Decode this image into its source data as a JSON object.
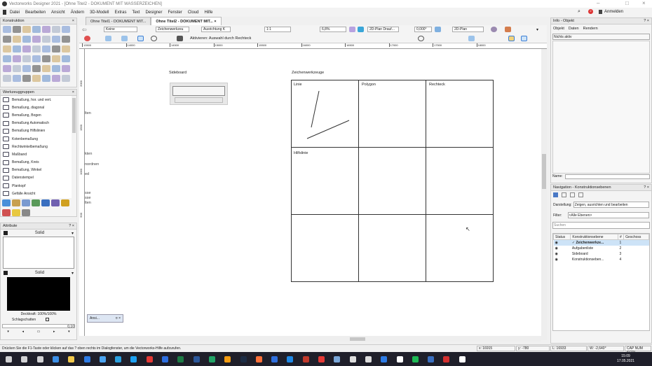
{
  "window": {
    "title": "Vectorworks Designer 2021 - [Ohne Titel2 - DOKUMENT MIT WASSERZEICHEN]",
    "account": "Anmelden",
    "notification_count": "2"
  },
  "menu": [
    "Datei",
    "Bearbeiten",
    "Ansicht",
    "Ändern",
    "3D-Modell",
    "Extras",
    "Text",
    "Designer",
    "Fenster",
    "Cloud",
    "Hilfe"
  ],
  "document_tabs": [
    {
      "label": "Ohne Titel1 - DOKUMENT MIT...",
      "active": false
    },
    {
      "label": "Ohne Titel2 - DOKUMENT MIT...",
      "active": true
    }
  ],
  "toolbar": {
    "class": "Keine",
    "layer": "Zeichenwerkzeu",
    "alignment": "Ausrichtung K",
    "scale": "1:1",
    "zoom": "6,8%",
    "view": "2D-Plan Drauf...",
    "rotation": "0,000°",
    "render": "2D-Plan",
    "mode_hint": "Aktivieren: Auswahl durch Rechteck"
  },
  "rulers": {
    "top": [
      "13500",
      "14000",
      "14500",
      "15000",
      "15500",
      "16000",
      "16500",
      "17000",
      "17500",
      "18000"
    ],
    "left": [
      "2000",
      "1500",
      "1000",
      "500"
    ]
  },
  "palettes": {
    "construction": {
      "title": "Konstruktion"
    },
    "tool_groups": {
      "title": "Werkzeuggruppen",
      "items": [
        "Bemaßung, hor. und vert.",
        "Bemaßung, diagonal",
        "Bemaßung, Bogen",
        "Bemaßung Automatisch",
        "Bemaßung Hilfslinien",
        "Kotenbemaßung",
        "Rechtwinkelbemaßung",
        "Maßband",
        "Bemaßung, Kreis",
        "Bemaßung, Winkel",
        "Datenstempel",
        "Plankopf",
        "Gefälle Ansicht"
      ]
    },
    "attributes": {
      "title": "Attribute",
      "fill_style": "Solid",
      "pen_style": "Solid",
      "opacity": "Deckkraft: 100%/100%",
      "shadow": "Schlagschatten",
      "line_weight": "0,10"
    }
  },
  "canvas": {
    "labels": {
      "sideboard": "Sideboard",
      "tools": "Zeichenwerkzeuge"
    },
    "cells": [
      "Linie",
      "Polygon",
      "Rechteck",
      "Hilfslinie"
    ],
    "ghost_fragments": [
      "lten",
      "kten",
      "nordnen",
      "ed",
      "sse",
      "sse",
      "lten"
    ],
    "mini_window": "Ansi..."
  },
  "info_panel": {
    "title": "Info - Objekt",
    "tabs": [
      "Objekt",
      "Daten",
      "Rendern"
    ],
    "status": "Nichts aktiv",
    "name_label": "Name:"
  },
  "navigation": {
    "title": "Navigation - Konstruktionsebenen",
    "display_label": "Darstellung:",
    "display_value": "Zeigen, ausrichten und bearbeiten",
    "filter_label": "Filter:",
    "filter_value": "<Alle Ebenen>",
    "search_placeholder": "Suchen",
    "columns": [
      "Status",
      "Konstruktionsebene",
      "#",
      "Geschoss"
    ],
    "rows": [
      {
        "name": "Zeichenwerkze...",
        "num": "1",
        "active": true
      },
      {
        "name": "Aufgabenliste",
        "num": "2",
        "active": false
      },
      {
        "name": "Sideboard",
        "num": "3",
        "active": false
      },
      {
        "name": "Konstruktionseben...",
        "num": "4",
        "active": false
      }
    ]
  },
  "statusbar": {
    "hint": "Drücken Sie die F1-Taste oder klicken auf das ? oben rechts im Dialogfenster, um die Vectorworks-Hilfe aufzurufen.",
    "x": "x: 16915",
    "y": "y: -780",
    "l": "L: 16933",
    "w": "W: -2,640°",
    "keys": "CAP NUM SCRL"
  },
  "taskbar": {
    "time": "15:09",
    "date": "17.05.2021"
  },
  "colors": {
    "accent": "#3c7fd6",
    "taskbar": "#1f1f2a",
    "selection": "#cde3f7"
  }
}
